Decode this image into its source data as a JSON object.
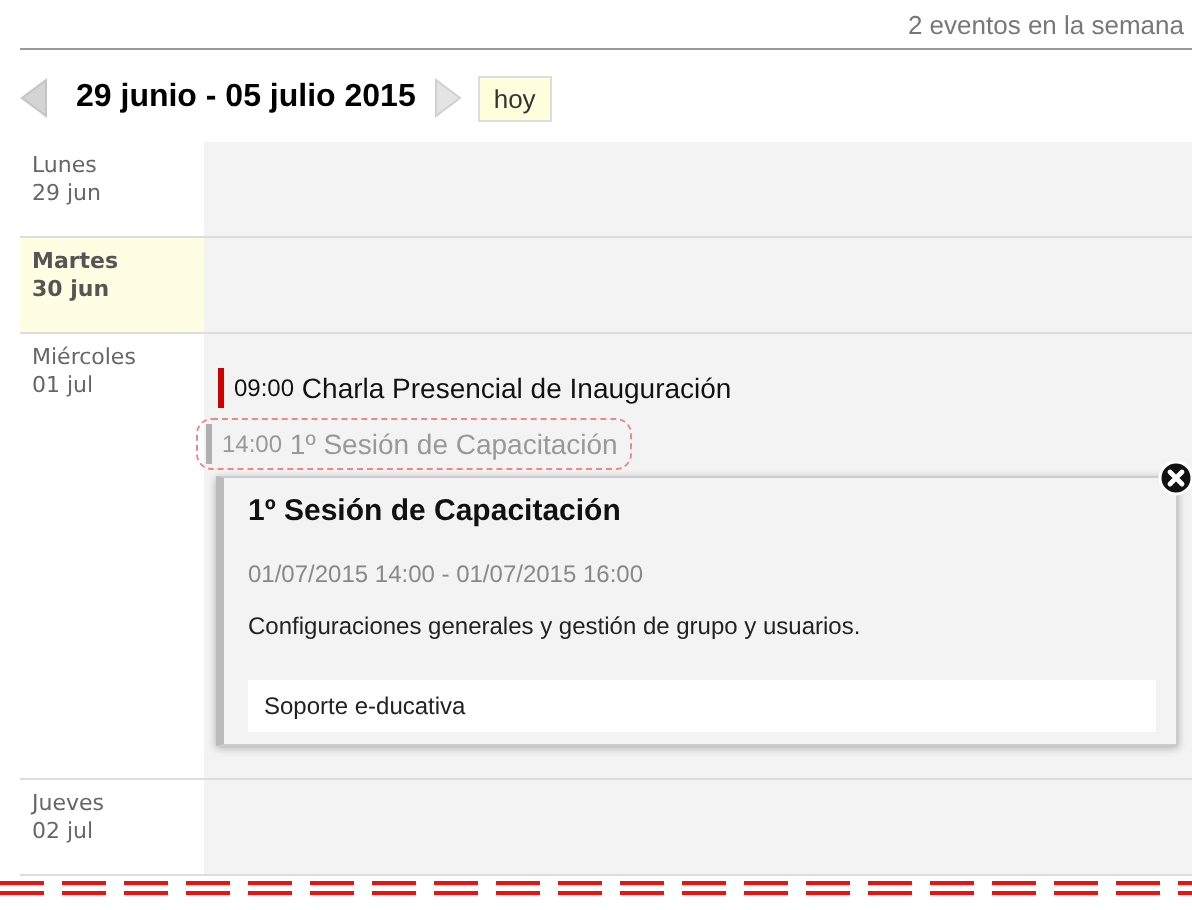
{
  "summary": "2 eventos en la semana",
  "nav": {
    "range": "29 junio - 05 julio 2015",
    "today_button": "hoy"
  },
  "days": [
    {
      "weekday": "Lunes",
      "date": "29 jun",
      "today": false
    },
    {
      "weekday": "Martes",
      "date": "30 jun",
      "today": true
    },
    {
      "weekday": "Miércoles",
      "date": "01 jul",
      "today": false,
      "events": [
        {
          "time": "09:00",
          "title": "Charla Presencial de Inauguración",
          "color": "#cc0000",
          "selected": false
        },
        {
          "time": "14:00",
          "title": "1º Sesión de Capacitación",
          "color": "#b0b0b0",
          "selected": true
        }
      ]
    },
    {
      "weekday": "Jueves",
      "date": "02 jul",
      "today": false
    }
  ],
  "popup": {
    "title": "1º Sesión de Capacitación",
    "datetime": "01/07/2015 14:00 - 01/07/2015 16:00",
    "description": "Configuraciones generales y gestión de grupo y usuarios.",
    "organizer": "Soporte e-ducativa"
  }
}
